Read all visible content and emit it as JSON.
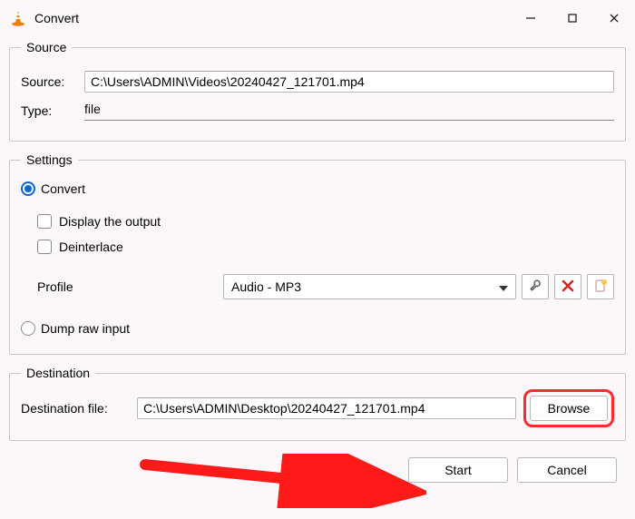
{
  "window": {
    "title": "Convert"
  },
  "source": {
    "legend": "Source",
    "source_label": "Source:",
    "source_value": "C:\\Users\\ADMIN\\Videos\\20240427_121701.mp4",
    "type_label": "Type:",
    "type_value": "file"
  },
  "settings": {
    "legend": "Settings",
    "convert_label": "Convert",
    "display_output_label": "Display the output",
    "deinterlace_label": "Deinterlace",
    "profile_label": "Profile",
    "profile_value": "Audio - MP3",
    "dump_label": "Dump raw input"
  },
  "destination": {
    "legend": "Destination",
    "dest_label": "Destination file:",
    "dest_value": "C:\\Users\\ADMIN\\Desktop\\20240427_121701.mp4",
    "browse_label": "Browse"
  },
  "buttons": {
    "start": "Start",
    "cancel": "Cancel"
  }
}
